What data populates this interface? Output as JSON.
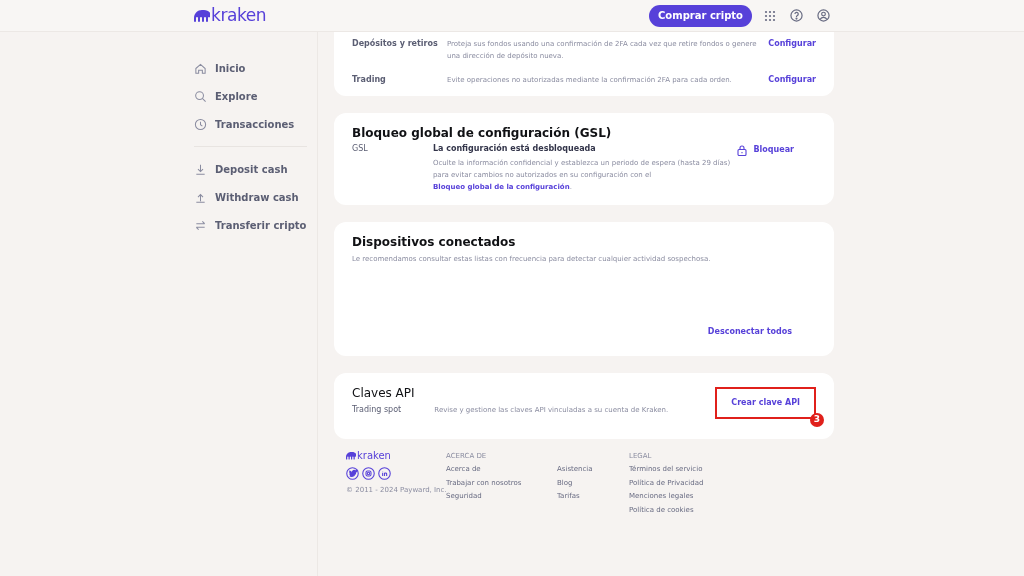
{
  "header": {
    "logo": "kraken",
    "buy_button": "Comprar cripto"
  },
  "sidebar": {
    "items": [
      {
        "label": "Inicio"
      },
      {
        "label": "Explore"
      },
      {
        "label": "Transacciones"
      },
      {
        "label": "Deposit cash"
      },
      {
        "label": "Withdraw cash"
      },
      {
        "label": "Transferir cripto"
      }
    ]
  },
  "twofa_card": {
    "rows": [
      {
        "label": "Depósitos y retiros",
        "description": "Proteja sus fondos usando una confirmación de 2FA cada vez que retire fondos o genere una dirección de depósito nueva.",
        "action": "Configurar"
      },
      {
        "label": "Trading",
        "description": "Evite operaciones no autorizadas mediante la confirmación 2FA para cada orden.",
        "action": "Configurar"
      }
    ]
  },
  "gsl_card": {
    "title": "Bloqueo global de configuración (GSL)",
    "label": "GSL",
    "status": "La configuración está desbloqueada",
    "description": "Oculte la información confidencial y establezca un periodo de espera (hasta 29 días) para evitar cambios no autorizados en su configuración con el",
    "link": "Bloqueo global de la configuración",
    "after_link": ".",
    "action": "Bloquear"
  },
  "devices_card": {
    "title": "Dispositivos conectados",
    "description": "Le recomendamos consultar estas listas con frecuencia para detectar cualquier actividad sospechosa.",
    "action": "Desconectar todos"
  },
  "api_card": {
    "title": "Claves API",
    "label": "Trading spot",
    "description": "Revise y gestione las claves API vinculadas a su cuenta de Kraken.",
    "action": "Crear clave API",
    "step_badge": "3"
  },
  "footer": {
    "logo": "kraken",
    "copyright": "© 2011 - 2024 Payward, Inc.",
    "columns": [
      {
        "heading": "ACERCA DE",
        "links": [
          "Acerca de",
          "Trabajar con nosotros",
          "Seguridad"
        ]
      },
      {
        "links": [
          "Asistencia",
          "Blog",
          "Tarifas"
        ]
      },
      {
        "heading": "LEGAL",
        "links": [
          "Términos del servicio",
          "Política de Privacidad",
          "Menciones legales",
          "Política de cookies"
        ]
      }
    ]
  }
}
